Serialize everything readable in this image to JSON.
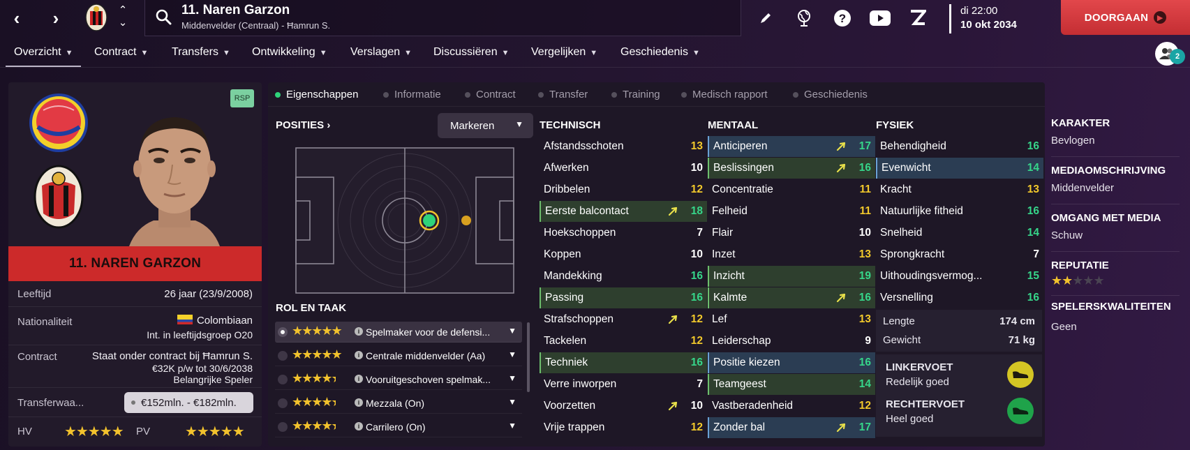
{
  "header": {
    "player_title": "11. Naren Garzon",
    "player_subtitle": "Middenvelder (Centraal) - Ħamrun S.",
    "date_day": "di 22:00",
    "date_full": "10 okt 2034",
    "continue_label": "DOORGAAN",
    "icons": [
      "back-icon",
      "forward-icon",
      "club-badge-icon",
      "search-icon",
      "edit-icon",
      "globe-icon",
      "help-icon",
      "youtube-icon",
      "z-icon"
    ]
  },
  "menu": {
    "items": [
      "Overzicht",
      "Contract",
      "Transfers",
      "Ontwikkeling",
      "Verslagen",
      "Discussiëren",
      "Vergelijken",
      "Geschiedenis"
    ],
    "people_count": "2"
  },
  "profile": {
    "rsp": "RSP",
    "banner_name": "11. NAREN GARZON",
    "age_label": "Leeftijd",
    "age_value": "26 jaar (23/9/2008)",
    "nationality_label": "Nationaliteit",
    "nationality_value": "Colombiaan",
    "nationality_sub": "Int. in leeftijdsgroep O20",
    "contract_label": "Contract",
    "contract_line1": "Staat onder contract bij Ħamrun S.",
    "contract_line2": "€32K p/w tot 30/6/2038",
    "contract_line3": "Belangrijke Speler",
    "transfer_label": "Transferwaa...",
    "transfer_value": "€152mln. - €182mln.",
    "hv_label": "HV",
    "pv_label": "PV",
    "hv_stars": 5,
    "pv_stars": 5
  },
  "subtabs": [
    "Eigenschappen",
    "Informatie",
    "Contract",
    "Transfer",
    "Training",
    "Medisch rapport",
    "Geschiedenis"
  ],
  "positions": {
    "title": "POSITIES",
    "dropdown": "Markeren",
    "role_title": "ROL EN TAAK",
    "roles": [
      {
        "name": "Spelmaker voor de defensi...",
        "stars": 5
      },
      {
        "name": "Centrale middenvelder (Aa)",
        "stars": 5
      },
      {
        "name": "Vooruitgeschoven spelmak...",
        "stars": 4.5
      },
      {
        "name": "Mezzala (On)",
        "stars": 4.5
      },
      {
        "name": "Carrilero (On)",
        "stars": 4.5
      }
    ]
  },
  "technical": {
    "title": "TECHNISCH",
    "rows": [
      {
        "label": "Afstandsschoten",
        "value": "13",
        "hl": "",
        "trend": false
      },
      {
        "label": "Afwerken",
        "value": "10",
        "hl": "",
        "trend": false
      },
      {
        "label": "Dribbelen",
        "value": "12",
        "hl": "",
        "trend": false
      },
      {
        "label": "Eerste balcontact",
        "value": "18",
        "hl": "green",
        "trend": true
      },
      {
        "label": "Hoekschoppen",
        "value": "7",
        "hl": "",
        "trend": false
      },
      {
        "label": "Koppen",
        "value": "10",
        "hl": "",
        "trend": false
      },
      {
        "label": "Mandekking",
        "value": "16",
        "hl": "",
        "trend": false
      },
      {
        "label": "Passing",
        "value": "16",
        "hl": "green",
        "trend": false
      },
      {
        "label": "Strafschoppen",
        "value": "12",
        "hl": "",
        "trend": true
      },
      {
        "label": "Tackelen",
        "value": "12",
        "hl": "",
        "trend": false
      },
      {
        "label": "Techniek",
        "value": "16",
        "hl": "green",
        "trend": false
      },
      {
        "label": "Verre inworpen",
        "value": "7",
        "hl": "",
        "trend": false
      },
      {
        "label": "Voorzetten",
        "value": "10",
        "hl": "",
        "trend": true
      },
      {
        "label": "Vrije trappen",
        "value": "12",
        "hl": "",
        "trend": false
      }
    ]
  },
  "mental": {
    "title": "MENTAAL",
    "rows": [
      {
        "label": "Anticiperen",
        "value": "17",
        "hl": "blue",
        "trend": true
      },
      {
        "label": "Beslissingen",
        "value": "16",
        "hl": "green",
        "trend": true
      },
      {
        "label": "Concentratie",
        "value": "11",
        "hl": "",
        "trend": false
      },
      {
        "label": "Felheid",
        "value": "11",
        "hl": "",
        "trend": false
      },
      {
        "label": "Flair",
        "value": "10",
        "hl": "",
        "trend": false
      },
      {
        "label": "Inzet",
        "value": "13",
        "hl": "",
        "trend": false
      },
      {
        "label": "Inzicht",
        "value": "19",
        "hl": "green",
        "trend": false
      },
      {
        "label": "Kalmte",
        "value": "16",
        "hl": "green",
        "trend": true
      },
      {
        "label": "Lef",
        "value": "13",
        "hl": "",
        "trend": false
      },
      {
        "label": "Leiderschap",
        "value": "9",
        "hl": "",
        "trend": false
      },
      {
        "label": "Positie kiezen",
        "value": "16",
        "hl": "blue",
        "trend": false
      },
      {
        "label": "Teamgeest",
        "value": "14",
        "hl": "green",
        "trend": false
      },
      {
        "label": "Vastberadenheid",
        "value": "12",
        "hl": "",
        "trend": false
      },
      {
        "label": "Zonder bal",
        "value": "17",
        "hl": "blue",
        "trend": true
      }
    ]
  },
  "physical": {
    "title": "FYSIEK",
    "rows": [
      {
        "label": "Behendigheid",
        "value": "16",
        "hl": "",
        "trend": false
      },
      {
        "label": "Evenwicht",
        "value": "14",
        "hl": "blue",
        "trend": false
      },
      {
        "label": "Kracht",
        "value": "13",
        "hl": "",
        "trend": false
      },
      {
        "label": "Natuurlijke fitheid",
        "value": "16",
        "hl": "",
        "trend": false
      },
      {
        "label": "Snelheid",
        "value": "14",
        "hl": "",
        "trend": false
      },
      {
        "label": "Sprongkracht",
        "value": "7",
        "hl": "",
        "trend": false
      },
      {
        "label": "Uithoudingsvermog...",
        "value": "15",
        "hl": "",
        "trend": false
      },
      {
        "label": "Versnelling",
        "value": "16",
        "hl": "",
        "trend": false
      }
    ],
    "height_label": "Lengte",
    "height_value": "174 cm",
    "weight_label": "Gewicht",
    "weight_value": "71 kg",
    "left_foot_label": "LINKERVOET",
    "left_foot_value": "Redelijk goed",
    "right_foot_label": "RECHTERVOET",
    "right_foot_value": "Heel goed"
  },
  "character": {
    "items": [
      {
        "title": "KARAKTER",
        "value": "Bevlogen"
      },
      {
        "title": "MEDIAOMSCHRIJVING",
        "value": "Middenvelder"
      },
      {
        "title": "OMGANG MET MEDIA",
        "value": "Schuw"
      },
      {
        "title": "REPUTATIE",
        "value": ""
      },
      {
        "title": "SPELERSKWALITEITEN",
        "value": "Geen"
      }
    ],
    "reputation_stars": 2
  },
  "colors": {
    "value_yellow": "#f2c92b",
    "value_green": "#36d68a",
    "value_white": "#ffffff",
    "accent_red": "#cc2a2a",
    "active_tab_dot": "#2fd37a"
  }
}
